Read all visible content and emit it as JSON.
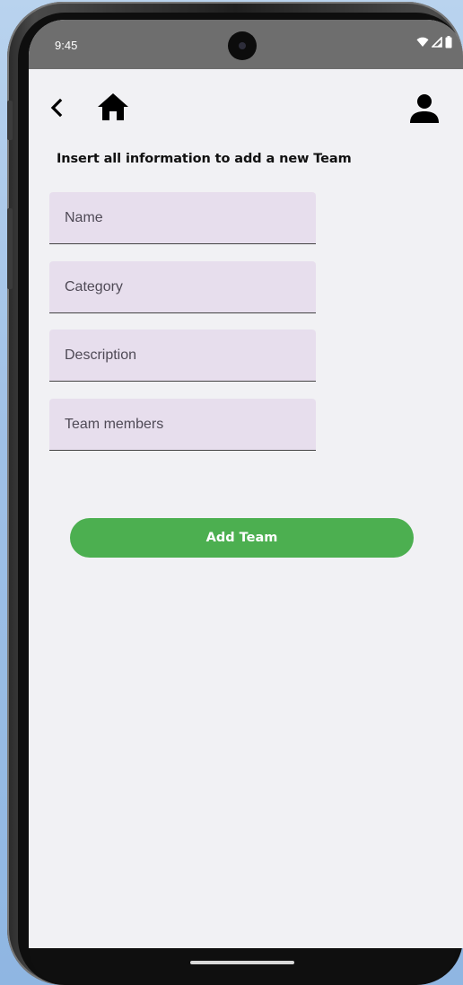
{
  "status_bar": {
    "time": "9:45",
    "icons": [
      "wifi-icon",
      "signal-icon",
      "battery-icon"
    ]
  },
  "app_bar": {
    "back_icon": "chevron-left-icon",
    "home_icon": "home-icon",
    "profile_icon": "person-icon"
  },
  "form": {
    "instruction": "Insert all information to add a new Team",
    "fields": [
      {
        "placeholder": "Name",
        "value": ""
      },
      {
        "placeholder": "Category",
        "value": ""
      },
      {
        "placeholder": "Description",
        "value": ""
      },
      {
        "placeholder": "Team members",
        "value": ""
      }
    ],
    "submit_label": "Add Team"
  },
  "colors": {
    "status_bar": "#6e6e6e",
    "screen_background": "#f1f1f4",
    "field_background": "#e7deed",
    "accent_button": "#4caf50"
  }
}
